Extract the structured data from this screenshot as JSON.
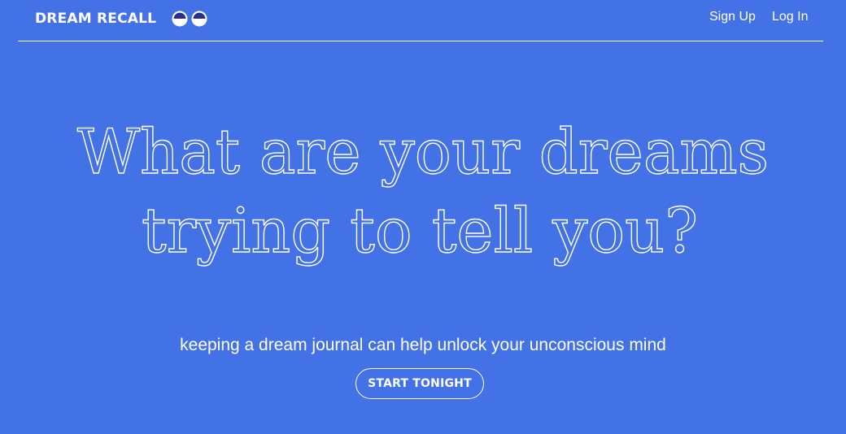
{
  "colors": {
    "background": "#4371e6",
    "foreground": "#ffffff"
  },
  "nav": {
    "brand": "DREAM RECALL",
    "logo_icon": "eyes-icon",
    "sign_up": "Sign Up",
    "log_in": "Log In"
  },
  "hero": {
    "headline_line1": "What are your dreams",
    "headline_line2": "trying to tell you?",
    "tagline": "keeping a dream journal can help unlock your unconscious mind",
    "cta_label": "START TONIGHT"
  }
}
